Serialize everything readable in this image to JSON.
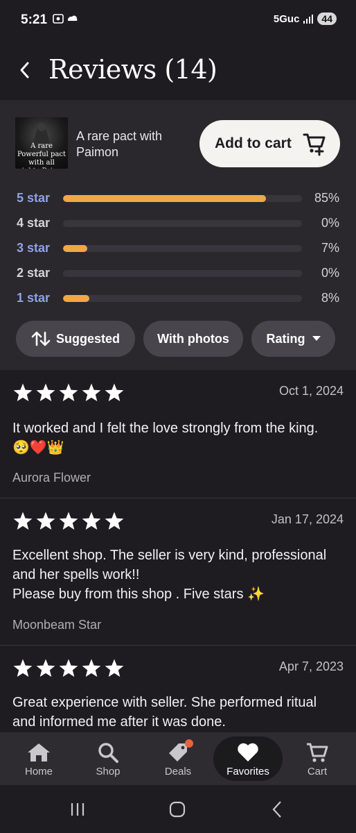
{
  "status_bar": {
    "time": "5:21",
    "network": "5Guc",
    "battery": "44"
  },
  "header": {
    "title": "Reviews (14)"
  },
  "listing": {
    "thumb_text": "A rare Powerful pact with all mighty Paimon",
    "title": "A rare pact with Paimon",
    "add_to_cart_label": "Add to cart"
  },
  "rating_breakdown": [
    {
      "label": "5 star",
      "percent_label": "85%",
      "fill": 0.85,
      "linked": true
    },
    {
      "label": "4 star",
      "percent_label": "0%",
      "fill": 0.0,
      "linked": false
    },
    {
      "label": "3 star",
      "percent_label": "7%",
      "fill": 0.1,
      "linked": true
    },
    {
      "label": "2 star",
      "percent_label": "0%",
      "fill": 0.0,
      "linked": false
    },
    {
      "label": "1 star",
      "percent_label": "8%",
      "fill": 0.11,
      "linked": true
    }
  ],
  "filters": {
    "suggested": "Suggested",
    "with_photos": "With photos",
    "rating": "Rating"
  },
  "reviews": [
    {
      "stars": 5,
      "date": "Oct 1, 2024",
      "text": "It worked and I felt the love strongly from the king. 🥺❤️👑",
      "author": "Aurora Flower"
    },
    {
      "stars": 5,
      "date": "Jan 17, 2024",
      "text": "Excellent shop.  The seller is very kind, professional and her spells work!!\nPlease buy from this shop . Five stars ✨",
      "author": "Moonbeam Star"
    },
    {
      "stars": 5,
      "date": "Apr 7, 2023",
      "text": "Great experience with seller. She performed ritual and informed me after it was done.",
      "author": ""
    }
  ],
  "bottom_nav": {
    "home": "Home",
    "shop": "Shop",
    "deals": "Deals",
    "favorites": "Favorites",
    "cart": "Cart"
  },
  "colors": {
    "accent_bar": "#f0a844",
    "link_blue": "#8fa3e4",
    "deals_dot": "#e8623a"
  }
}
